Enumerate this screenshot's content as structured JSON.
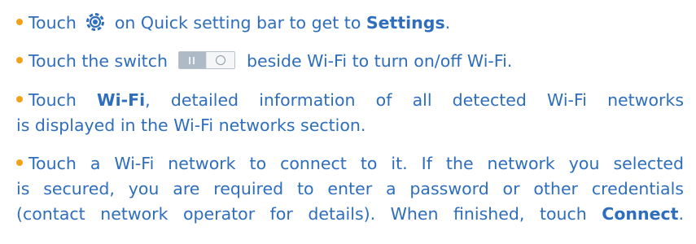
{
  "colors": {
    "text": "#2e6ebd",
    "bullet": "#f2a218",
    "gear_icon": "#2e6ebd",
    "switch_track": "#dfe5ea"
  },
  "icons": {
    "settings": "gear-icon",
    "switch": "wifi-toggle-switch-icon"
  },
  "items": [
    {
      "lines": [
        {
          "a": "Touch ",
          "b": " on Quick setting bar to get to ",
          "c": "Settings",
          "d": "."
        }
      ]
    },
    {
      "lines": [
        {
          "a": "Touch the switch ",
          "b": " beside Wi-Fi to  turn on/off Wi-Fi."
        }
      ]
    },
    {
      "lines": [
        {
          "a": "Touch ",
          "b": "Wi-Fi",
          "c": ", detailed information of all detected Wi-Fi networks"
        },
        {
          "a": "is displayed in the Wi-Fi networks section."
        }
      ]
    },
    {
      "lines": [
        {
          "a": "Touch a Wi-Fi network to connect to it. If the network you selected"
        },
        {
          "a": "is secured, you are required to enter a password or other credentials"
        },
        {
          "a": "(contact network operator for details). When finished, touch ",
          "b": "Connect",
          "c": "."
        }
      ]
    }
  ]
}
